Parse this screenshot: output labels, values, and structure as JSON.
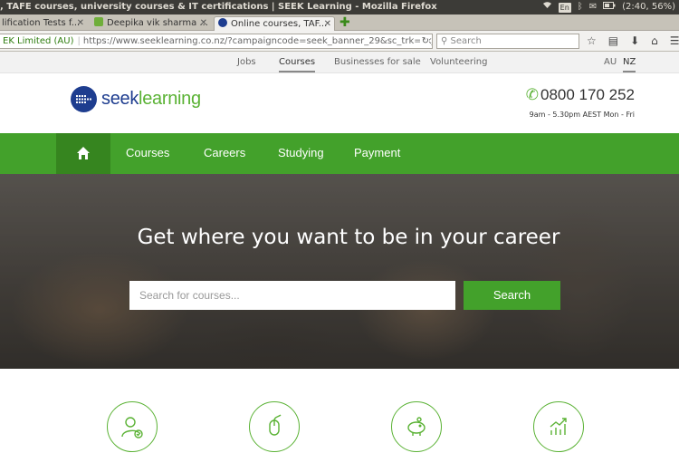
{
  "os": {
    "window_title": ", TAFE courses, university courses & IT certifications | SEEK Learning - Mozilla Firefox",
    "keyboard": "En",
    "battery": "(2:40, 56%)"
  },
  "browser": {
    "tabs": [
      {
        "label": "lification Tests f...",
        "active": false
      },
      {
        "label": "Deepika vik sharma ...",
        "active": false
      },
      {
        "label": "Online courses, TAF...",
        "active": true
      }
    ],
    "identity": "EK Limited (AU)",
    "url": "https://www.seeklearning.co.nz/?campaigncode=seek_banner_29&sc_trk=skj-courses-lin",
    "search_placeholder": "Search"
  },
  "site": {
    "topnav": [
      {
        "label": "Jobs"
      },
      {
        "label": "Courses"
      },
      {
        "label": "Businesses for sale"
      },
      {
        "label": "Volunteering"
      }
    ],
    "regions": [
      "AU",
      "NZ"
    ],
    "logo": {
      "part1": "seek",
      "part2": "learning"
    },
    "phone": "0800 170 252",
    "hours": "9am - 5.30pm AEST Mon - Fri",
    "menu": [
      {
        "label": "Courses"
      },
      {
        "label": "Careers"
      },
      {
        "label": "Studying"
      },
      {
        "label": "Payment"
      }
    ],
    "hero": {
      "headline": "Get where you want to be in your career",
      "search_placeholder": "Search for courses...",
      "search_button": "Search"
    },
    "features_icons": [
      "graduate-check-icon",
      "mouse-icon",
      "piggy-bank-icon",
      "growth-chart-icon"
    ]
  },
  "colors": {
    "brand_green": "#43a12b",
    "brand_navy": "#1e3d8f"
  }
}
